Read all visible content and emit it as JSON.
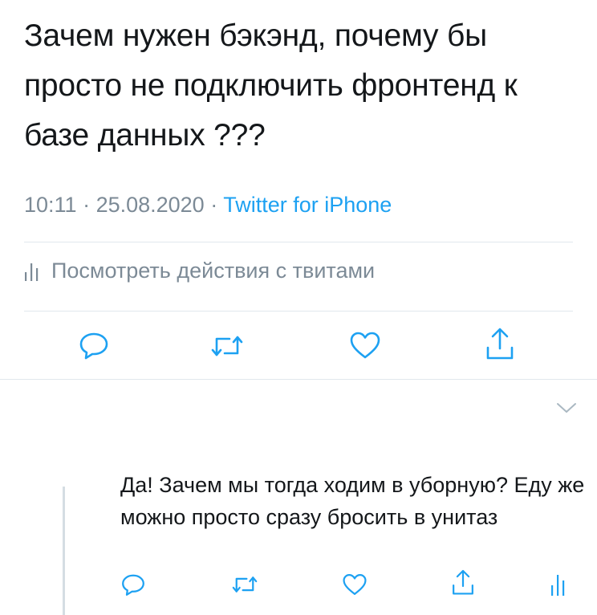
{
  "tweet": {
    "text": "Зачем нужен бэкэнд, почему бы просто не подключить фронтенд к базе данных ???",
    "time": "10:11",
    "sep1": " · ",
    "date": "25.08.2020",
    "sep2": " · ",
    "source": "Twitter for iPhone",
    "activity_label": "Посмотреть действия с твитами"
  },
  "actions": [
    "reply-icon",
    "retweet-icon",
    "like-icon",
    "share-icon"
  ],
  "reply": {
    "text": "Да! Зачем мы тогда ходим в уборную? Еду же можно просто сразу бросить в унитаз",
    "actions": [
      "reply-icon",
      "retweet-icon",
      "like-icon",
      "share-icon",
      "analytics-icon"
    ]
  },
  "colors": {
    "text": "#14171a",
    "muted": "#7c8a96",
    "accent": "#1da1f2",
    "divider": "#e1e8ed"
  }
}
